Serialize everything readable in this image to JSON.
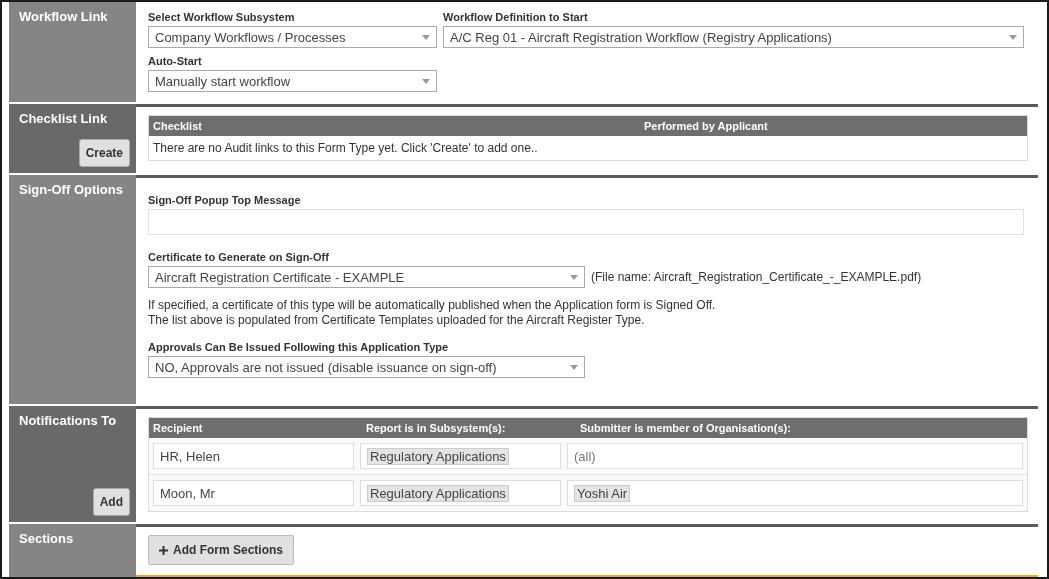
{
  "workflow_link": {
    "title": "Workflow Link",
    "subsystem": {
      "label": "Select Workflow Subsystem",
      "value": "Company Workflows / Processes"
    },
    "definition": {
      "label": "Workflow Definition to Start",
      "value": "A/C Reg 01 - Aircraft Registration Workflow (Registry Applications)"
    },
    "auto_start": {
      "label": "Auto-Start",
      "value": "Manually start workflow"
    }
  },
  "checklist_link": {
    "title": "Checklist Link",
    "create_button": "Create",
    "columns": [
      "Checklist",
      "Performed by Applicant"
    ],
    "empty_message": "There are no Audit links to this Form Type yet. Click 'Create' to add one.."
  },
  "sign_off_options": {
    "title": "Sign-Off Options",
    "popup_message": {
      "label": "Sign-Off Popup Top Message"
    },
    "certificate": {
      "label": "Certificate to Generate on Sign-Off",
      "value": "Aircraft Registration Certificate - EXAMPLE",
      "file_name": "(File name: Aircraft_Registration_Certificate_-_EXAMPLE.pdf)"
    },
    "help_lines": [
      "If specified, a certificate of this type will be automatically published when the Application form is Signed Off.",
      "The list above is populated from Certificate Templates uploaded for the Aircraft Register Type."
    ],
    "approvals": {
      "label": "Approvals Can Be Issued Following this Application Type",
      "value": "NO, Approvals are not issued (disable issuance on sign-off)"
    }
  },
  "notifications_to": {
    "title": "Notifications To",
    "add_button": "Add",
    "columns": [
      "Recipient",
      "Report is in Subsystem(s):",
      "Submitter is member of Organisation(s):"
    ],
    "rows": [
      {
        "recipient": "HR, Helen",
        "subsystems": [
          "Regulatory Applications"
        ],
        "organisations_placeholder": "(all)"
      },
      {
        "recipient": "Moon, Mr",
        "subsystems": [
          "Regulatory Applications"
        ],
        "organisations": [
          "Yoshi Air"
        ]
      }
    ]
  },
  "sections": {
    "title": "Sections",
    "add_button": "Add Form Sections"
  }
}
